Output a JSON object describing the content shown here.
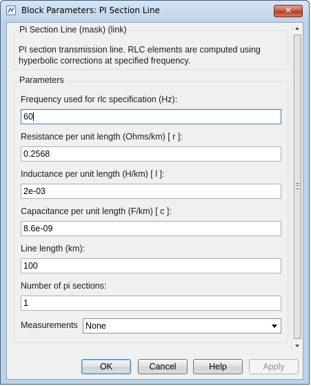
{
  "window": {
    "title": "Block Parameters: PI Section Line",
    "close_glyph": "✕"
  },
  "mask": {
    "title": "Pi Section Line (mask) (link)",
    "description": "PI section transmission line. RLC elements are computed using hyperbolic corrections at specified frequency."
  },
  "parameters": {
    "title": "Parameters",
    "fields": [
      {
        "label": "Frequency used for rlc specification (Hz):",
        "value": "60"
      },
      {
        "label": "Resistance per unit length (Ohms/km) [ r ]:",
        "value": "0.2568"
      },
      {
        "label": "Inductance per unit length (H/km) [ l ]:",
        "value": "2e-03"
      },
      {
        "label": "Capacitance per unit length (F/km) [ c ]:",
        "value": "8.6e-09"
      },
      {
        "label": "Line length (km):",
        "value": "100"
      },
      {
        "label": "Number of pi sections:",
        "value": "1"
      }
    ],
    "measurements": {
      "label": "Measurements",
      "selected": "None"
    }
  },
  "buttons": {
    "ok": "OK",
    "cancel": "Cancel",
    "help": "Help",
    "apply": "Apply"
  },
  "colors": {
    "title_bar": "#bdd3ea",
    "close_button": "#c75a44",
    "focus_border": "#3d7bad"
  }
}
